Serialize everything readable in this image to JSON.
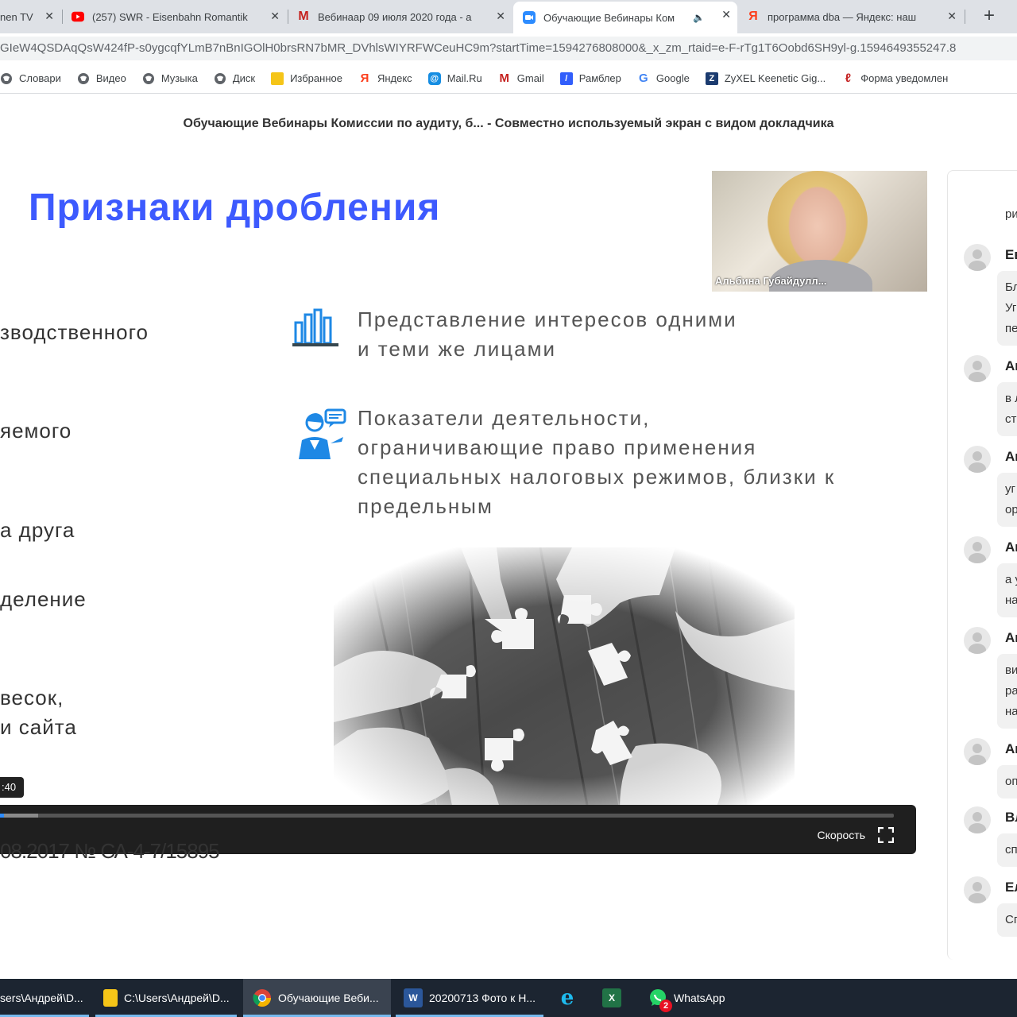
{
  "browser": {
    "tabs": [
      {
        "title": "nen TV",
        "favicon": "tv-icon"
      },
      {
        "title": "(257) SWR - Eisenbahn Romantik",
        "favicon": "youtube-icon",
        "favicon_color": "#ff0000"
      },
      {
        "title": "Вебинаар 09 июля 2020 года - а",
        "favicon": "gmail-icon",
        "favicon_color": "#c5221f"
      },
      {
        "title": "Обучающие Вебинары Ком",
        "favicon": "zoom-icon",
        "favicon_color": "#2d8cff",
        "active": true
      },
      {
        "title": "программа dba — Яндекс: наш",
        "favicon": "yandex-icon",
        "favicon_color": "#fc3f1d"
      }
    ],
    "url": "GIeW4QSDAqQsW424fP-s0ygcqfYLmB7nBnIGOlH0brsRN7bMR_DVhlsWIYRFWCeuHC9m?startTime=1594276808000&_x_zm_rtaid=e-F-rTg1T6Oobd6SH9yl-g.1594649355247.8",
    "bookmarks": [
      {
        "label": "Словари",
        "icon": "globe-icon"
      },
      {
        "label": "Видео",
        "icon": "globe-icon"
      },
      {
        "label": "Музыка",
        "icon": "globe-icon"
      },
      {
        "label": "Диск",
        "icon": "globe-icon"
      },
      {
        "label": "Избранное",
        "icon": "folder-icon"
      },
      {
        "label": "Яндекс",
        "icon": "yandex-icon"
      },
      {
        "label": "Mail.Ru",
        "icon": "mailru-icon"
      },
      {
        "label": "Gmail",
        "icon": "gmail-icon"
      },
      {
        "label": "Рамблер",
        "icon": "rambler-icon"
      },
      {
        "label": "Google",
        "icon": "google-icon"
      },
      {
        "label": "ZyXEL Keenetic Gig...",
        "icon": "zyxel-icon"
      },
      {
        "label": "Форма уведомлен",
        "icon": "form-icon"
      }
    ]
  },
  "meeting": {
    "title": "Обучающие Вебинары Комиссии по аудиту, б...  - Совместно используемый экран с видом докладчика"
  },
  "slide": {
    "title": "Признаки дробления",
    "left_items": [
      "зводственного",
      "яемого",
      "а друга",
      "деление",
      "весок,",
      "и сайта"
    ],
    "right_items": [
      "Представление интересов одними и теми же лицами",
      "Показатели деятельности, ограничивающие право применения специальных налоговых режимов, близки к предельным"
    ],
    "right_lines": [
      [
        "Представление интересов одними",
        "и теми же лицами"
      ],
      [
        "Показатели деятельности,",
        "ограничивающие право применения",
        "специальных налоговых режимов, близки к",
        "предельным"
      ]
    ],
    "doc_ref": "08.2017 № СА-4-7/15895"
  },
  "speaker": {
    "name": "Альбина Губайдулл..."
  },
  "player": {
    "time_bubble": ":40",
    "speed_label": "Скорость",
    "progress_fraction": 0.004,
    "buffered_fraction": 0.043
  },
  "chat": {
    "messages": [
      {
        "name": "",
        "text": "ри"
      },
      {
        "name": "Ев",
        "text": [
          "Бл",
          "Уг",
          "пе"
        ]
      },
      {
        "name": "Ан",
        "text": [
          "в л",
          "ст"
        ]
      },
      {
        "name": "Ан",
        "text": [
          "уг",
          "ор"
        ]
      },
      {
        "name": "Ан",
        "text": [
          "а у",
          "на"
        ]
      },
      {
        "name": "Ан",
        "text": [
          "ви",
          "ра",
          "на"
        ]
      },
      {
        "name": "Ан",
        "text": [
          "оп"
        ]
      },
      {
        "name": "Вл",
        "text": [
          "сп"
        ]
      },
      {
        "name": "Ел",
        "text": [
          "Сп"
        ]
      }
    ]
  },
  "taskbar": {
    "items": [
      {
        "label": "sers\\Андрей\\D...",
        "icon": "folder-icon"
      },
      {
        "label": "C:\\Users\\Андрей\\D...",
        "icon": "folder-icon"
      },
      {
        "label": "Обучающие Веби...",
        "icon": "chrome-icon",
        "active": true
      },
      {
        "label": "20200713 Фото к Н...",
        "icon": "word-icon"
      },
      {
        "label": "",
        "icon": "ie-icon"
      },
      {
        "label": "",
        "icon": "excel-icon"
      },
      {
        "label": "WhatsApp",
        "icon": "whatsapp-icon",
        "badge": "2"
      }
    ]
  },
  "colors": {
    "slide_title": "#3d5afe",
    "icon_blue": "#1e88e5",
    "zoom_blue": "#2d8cff"
  }
}
